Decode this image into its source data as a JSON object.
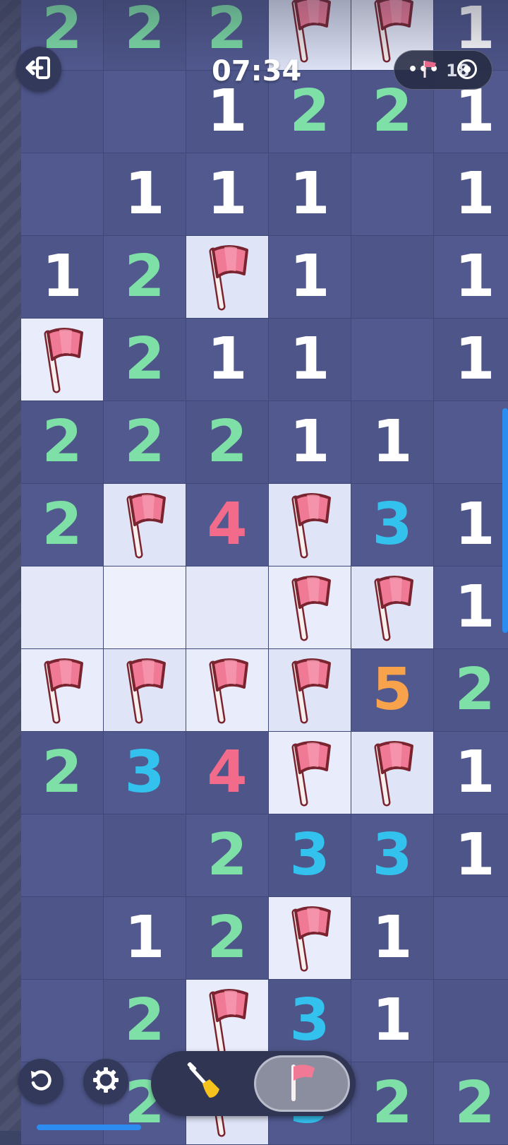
{
  "header": {
    "timer": "07:34",
    "flags_remaining": "18"
  },
  "icons": {
    "exit": "exit-icon",
    "undo": "undo-icon",
    "settings": "gear-icon",
    "dig": "shovel-icon",
    "flag": "flag-icon",
    "more": "more-dots-icon",
    "record": "record-icon"
  },
  "colors": {
    "tile_dark": "#51598f",
    "tile_light": "#e9edfb",
    "num_1": "#ffffff",
    "num_2": "#7ee0a7",
    "num_3": "#33c1ee",
    "num_4": "#f26b8b",
    "num_5": "#f8a24c",
    "flag": "#f07a96",
    "accent": "#2d8cf0"
  },
  "toolbar": {
    "active_mode": "flag"
  },
  "board": {
    "rows": [
      [
        "2",
        "2",
        "2",
        "F",
        "F",
        "1"
      ],
      [
        "",
        "",
        "1",
        "2",
        "2",
        "1"
      ],
      [
        "",
        "1",
        "1",
        "1",
        "",
        "1"
      ],
      [
        "1",
        "2",
        "F",
        "1",
        "",
        "1"
      ],
      [
        "F",
        "2",
        "1",
        "1",
        "",
        "1"
      ],
      [
        "2",
        "2",
        "2",
        "1",
        "1",
        ""
      ],
      [
        "2",
        "F",
        "4",
        "F",
        "3",
        "1"
      ],
      [
        "o",
        "o",
        "o",
        "F",
        "F",
        "1"
      ],
      [
        "F",
        "F",
        "F",
        "F",
        "5",
        "2"
      ],
      [
        "2",
        "3",
        "4",
        "F",
        "F",
        "1"
      ],
      [
        "",
        "",
        "2",
        "3",
        "3",
        "1"
      ],
      [
        "",
        "1",
        "2",
        "F",
        "1",
        ""
      ],
      [
        "",
        "2",
        "F",
        "3",
        "1",
        ""
      ],
      [
        "",
        "2",
        "F",
        "3",
        "2",
        "2"
      ]
    ]
  }
}
